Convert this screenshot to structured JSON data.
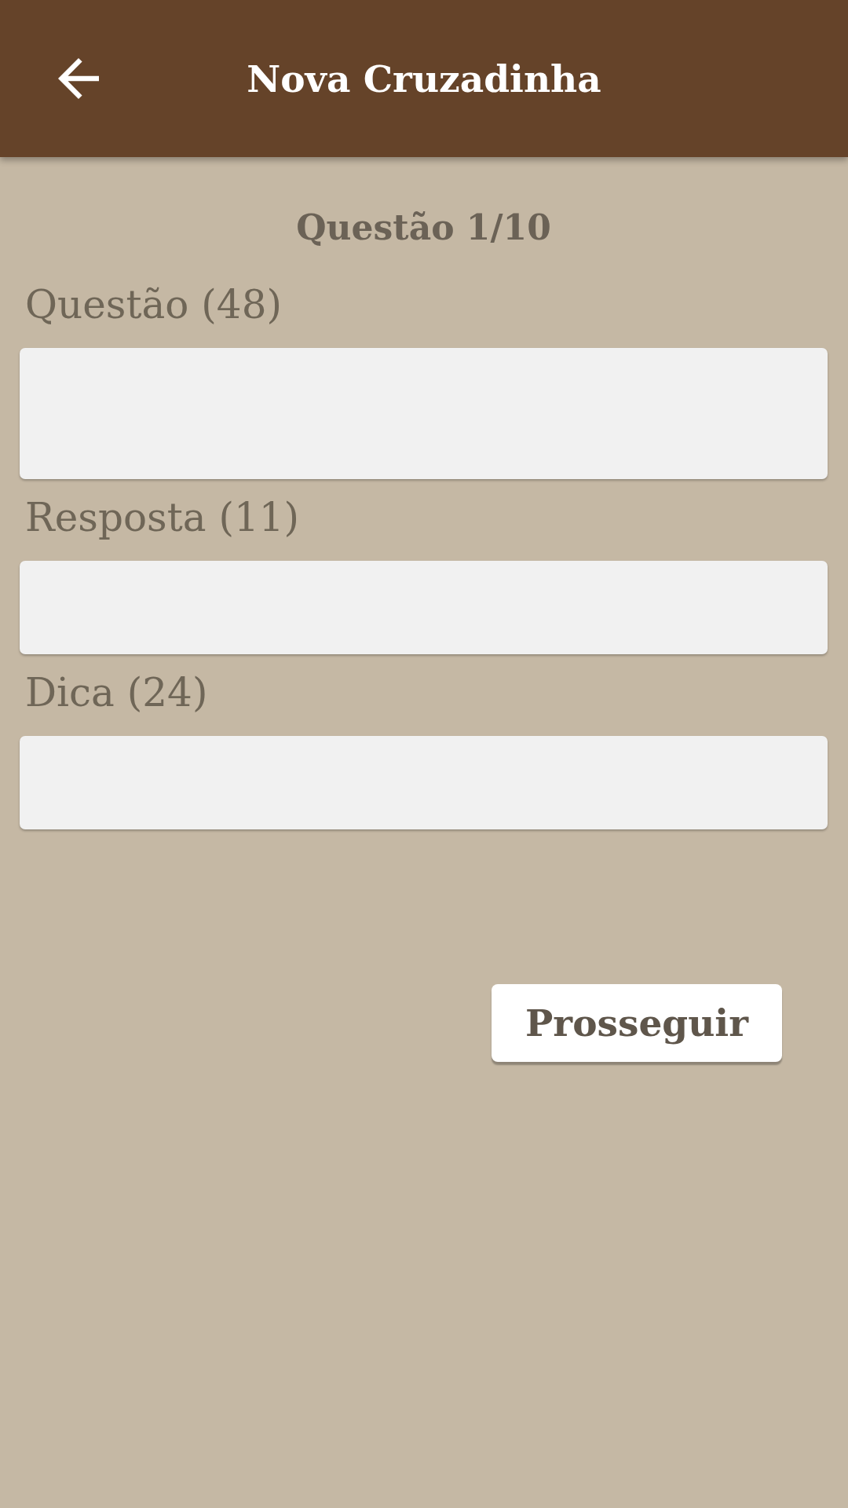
{
  "app_bar": {
    "title": "Nova Cruzadinha"
  },
  "counter": "Questão 1/10",
  "fields": [
    {
      "kind": "multiline",
      "label": "Questão (48)"
    },
    {
      "kind": "single",
      "label": "Resposta (11)"
    },
    {
      "kind": "single",
      "label": "Dica (24)"
    }
  ],
  "button": "Prosseguir"
}
